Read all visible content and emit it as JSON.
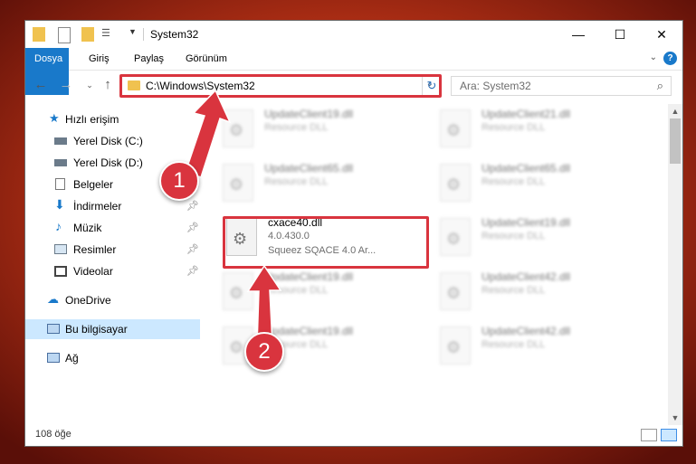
{
  "window": {
    "title": "System32"
  },
  "ribbon": {
    "tabs": [
      "Dosya",
      "Giriş",
      "Paylaş",
      "Görünüm"
    ]
  },
  "address": {
    "path": "C:\\Windows\\System32",
    "search_placeholder": "Ara: System32"
  },
  "nav": {
    "quick_access": "Hızlı erişim",
    "items": [
      {
        "label": "Yerel Disk (C:)",
        "pinned": false
      },
      {
        "label": "Yerel Disk (D:)",
        "pinned": false
      },
      {
        "label": "Belgeler",
        "pinned": true
      },
      {
        "label": "İndirmeler",
        "pinned": true
      },
      {
        "label": "Müzik",
        "pinned": true
      },
      {
        "label": "Resimler",
        "pinned": true
      },
      {
        "label": "Videolar",
        "pinned": true
      }
    ],
    "onedrive": "OneDrive",
    "this_pc": "Bu bilgisayar",
    "network": "Ağ"
  },
  "files": {
    "highlighted": {
      "name": "cxace40.dll",
      "version": "4.0.430.0",
      "description": "Squeez SQACE 4.0 Ar..."
    },
    "background": [
      {
        "name": "UpdateClient19.dll",
        "type": "Resource DLL"
      },
      {
        "name": "UpdateClient21.dll",
        "type": "Resource DLL"
      },
      {
        "name": "UpdateClient65.dll",
        "type": "Resource DLL"
      },
      {
        "name": "UpdateClient65.dll",
        "type": "Resource DLL"
      },
      {
        "name": "UpdateClient19.dll",
        "type": "Resource DLL"
      },
      {
        "name": "UpdateClient19.dll",
        "type": "Resource DLL"
      },
      {
        "name": "UpdateClient42.dll",
        "type": "Resource DLL"
      },
      {
        "name": "UpdateClient19.dll",
        "type": "Resource DLL"
      },
      {
        "name": "UpdateClient42.dll",
        "type": "Resource DLL"
      }
    ]
  },
  "status": {
    "count": "108 öğe"
  },
  "annotations": {
    "step1": "1",
    "step2": "2",
    "color": "#d9343e"
  }
}
